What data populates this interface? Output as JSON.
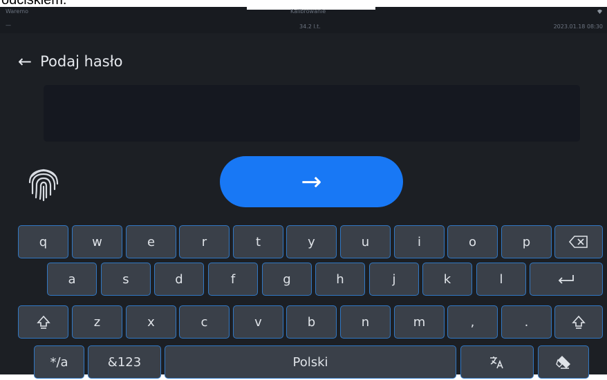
{
  "page_fragment": {
    "text": "odciskiem."
  },
  "status_bar": {
    "top_left": "Waremo",
    "top_center": "Kalibrowanie",
    "mid_center": "34.2 l.t.",
    "right": "2023.01.18 08:30",
    "left_mark": "—",
    "wifi_icon": "wifi-icon"
  },
  "header": {
    "back_icon": "←",
    "title": "Podaj hasło"
  },
  "password": {
    "value": "",
    "placeholder": ""
  },
  "fingerprint_icon": "fingerprint-icon",
  "submit": {
    "icon": "→",
    "icon_name": "arrow-right-icon",
    "color": "#1878f5"
  },
  "keyboard": {
    "row1": [
      "q",
      "w",
      "e",
      "r",
      "t",
      "y",
      "u",
      "i",
      "o",
      "p"
    ],
    "row2": [
      "a",
      "s",
      "d",
      "f",
      "g",
      "h",
      "j",
      "k",
      "l"
    ],
    "row3": [
      "z",
      "x",
      "c",
      "v",
      "b",
      "n",
      "m",
      ",",
      "."
    ],
    "symbols_key": "*/a",
    "numbers_key": "&123",
    "space_key": "Polski",
    "icons": {
      "backspace": "backspace-icon",
      "enter": "enter-icon",
      "shift": "shift-icon",
      "translate": "translate-icon",
      "hide": "hide-keyboard-icon"
    },
    "key_color": "#3a4049",
    "key_border_color": "#3178c4"
  }
}
